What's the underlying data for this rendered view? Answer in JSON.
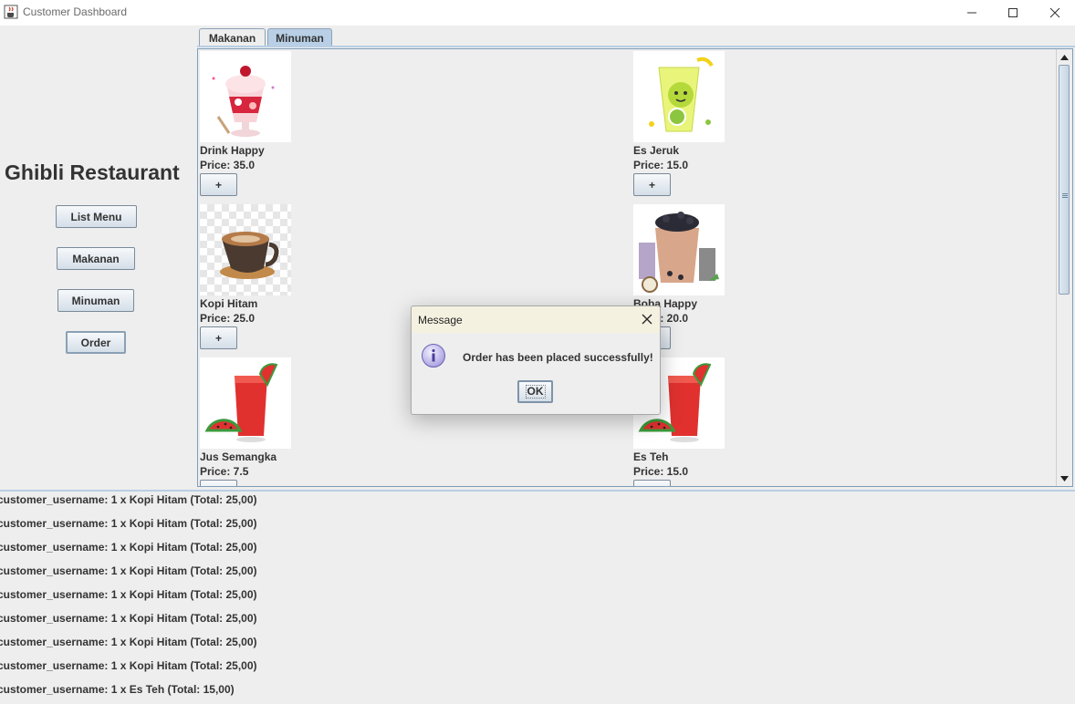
{
  "window": {
    "title": "Customer Dashboard",
    "app_icon": "java-cup-icon",
    "controls": [
      "minimize-icon",
      "maximize-icon",
      "close-icon"
    ]
  },
  "sidebar": {
    "restaurant_name": "Ghibli Restaurant",
    "buttons": [
      "List Menu",
      "Makanan",
      "Minuman",
      "Order"
    ]
  },
  "tabs": {
    "items": [
      "Makanan",
      "Minuman"
    ],
    "selected": "Minuman"
  },
  "menu_items": [
    {
      "name": "Drink Happy",
      "price": "Price: 35.0",
      "add_label": "+",
      "image": "strawberry-parfait"
    },
    {
      "name": "Es Jeruk",
      "price": "Price: 15.0",
      "add_label": "+",
      "image": "lime-juice"
    },
    {
      "name": "Kopi Hitam",
      "price": "Price: 25.0",
      "add_label": "+",
      "image": "coffee-cup"
    },
    {
      "name": "Boba Happy",
      "price": "Price: 20.0",
      "add_label": "+",
      "image": "boba-tea"
    },
    {
      "name": "Jus Semangka",
      "price": "Price: 7.5",
      "add_label": "+",
      "image": "watermelon-juice"
    },
    {
      "name": "Es Teh",
      "price": "Price: 15.0",
      "add_label": "+",
      "image": "watermelon-juice"
    }
  ],
  "orders": [
    "customer_username: 1 x Kopi Hitam (Total: 25,00)",
    "customer_username: 1 x Kopi Hitam (Total: 25,00)",
    "customer_username: 1 x Kopi Hitam (Total: 25,00)",
    "customer_username: 1 x Kopi Hitam (Total: 25,00)",
    "customer_username: 1 x Kopi Hitam (Total: 25,00)",
    "customer_username: 1 x Kopi Hitam (Total: 25,00)",
    "customer_username: 1 x Kopi Hitam (Total: 25,00)",
    "customer_username: 1 x Kopi Hitam (Total: 25,00)",
    "customer_username: 1 x Es Teh (Total: 15,00)"
  ],
  "dialog": {
    "title": "Message",
    "message": "Order has been placed successfully!",
    "ok_label": "OK",
    "icon": "info-icon"
  },
  "colors": {
    "selected_tab": "#b8cfe5",
    "border_accent": "#7f9db9",
    "dialog_titlebar": "#f5f1e1"
  }
}
